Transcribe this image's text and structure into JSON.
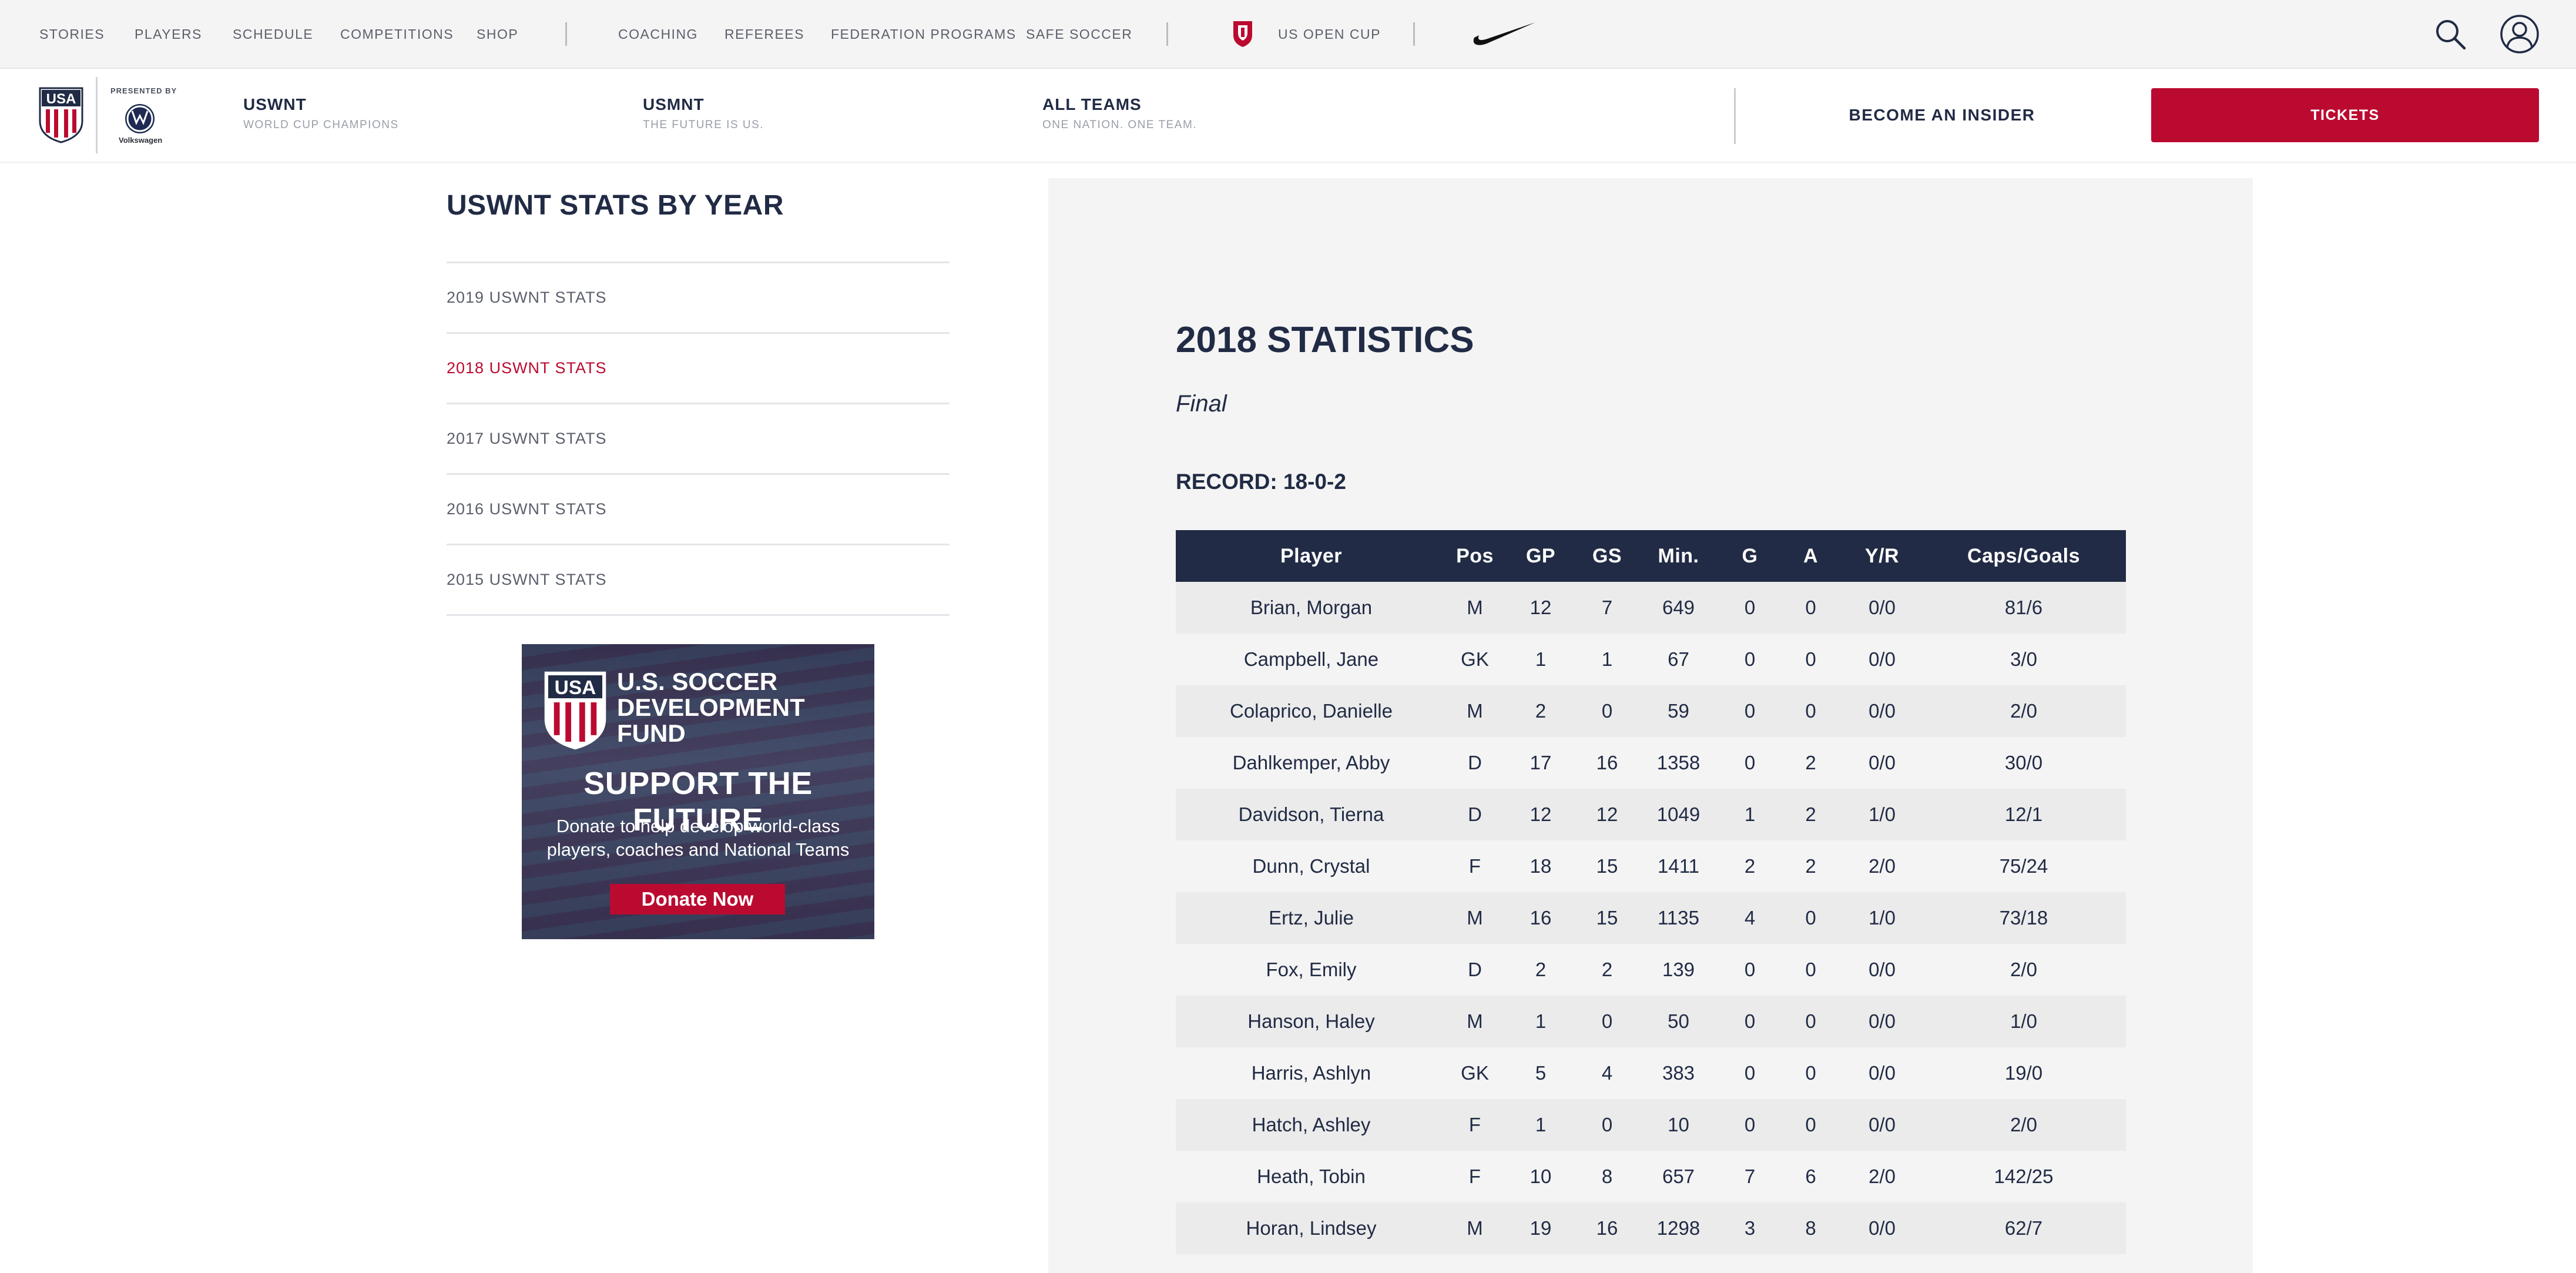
{
  "topnav": {
    "links": [
      "STORIES",
      "PLAYERS",
      "SCHEDULE",
      "COMPETITIONS",
      "SHOP",
      "COACHING",
      "REFEREES",
      "FEDERATION PROGRAMS",
      "SAFE SOCCER",
      "US OPEN CUP"
    ]
  },
  "header": {
    "logo_text": "USA",
    "presented_by": "PRESENTED BY",
    "sponsor": "Volkswagen",
    "teams": [
      {
        "title": "USWNT",
        "subtitle": "WORLD CUP CHAMPIONS"
      },
      {
        "title": "USMNT",
        "subtitle": "THE FUTURE IS US."
      },
      {
        "title": "ALL TEAMS",
        "subtitle": "ONE NATION. ONE TEAM."
      }
    ],
    "insider_label": "BECOME AN INSIDER",
    "tickets_label": "TICKETS"
  },
  "sidebar": {
    "title": "USWNT STATS BY YEAR",
    "items": [
      {
        "label": "2019 USWNT STATS",
        "active": false
      },
      {
        "label": "2018 USWNT STATS",
        "active": true
      },
      {
        "label": "2017 USWNT STATS",
        "active": false
      },
      {
        "label": "2016 USWNT STATS",
        "active": false
      },
      {
        "label": "2015 USWNT STATS",
        "active": false
      }
    ]
  },
  "ad": {
    "title": "U.S. SOCCER DEVELOPMENT FUND",
    "headline": "SUPPORT THE FUTURE",
    "body": "Donate to help develop world-class players, coaches and National Teams",
    "button": "Donate Now"
  },
  "stats": {
    "title": "2018 STATISTICS",
    "status": "Final",
    "record": "RECORD: 18-0-2",
    "columns": [
      "Player",
      "Pos",
      "GP",
      "GS",
      "Min.",
      "G",
      "A",
      "Y/R",
      "Caps/Goals"
    ],
    "rows": [
      [
        "Brian, Morgan",
        "M",
        "12",
        "7",
        "649",
        "0",
        "0",
        "0/0",
        "81/6"
      ],
      [
        "Campbell, Jane",
        "GK",
        "1",
        "1",
        "67",
        "0",
        "0",
        "0/0",
        "3/0"
      ],
      [
        "Colaprico, Danielle",
        "M",
        "2",
        "0",
        "59",
        "0",
        "0",
        "0/0",
        "2/0"
      ],
      [
        "Dahlkemper, Abby",
        "D",
        "17",
        "16",
        "1358",
        "0",
        "2",
        "0/0",
        "30/0"
      ],
      [
        "Davidson, Tierna",
        "D",
        "12",
        "12",
        "1049",
        "1",
        "2",
        "1/0",
        "12/1"
      ],
      [
        "Dunn, Crystal",
        "F",
        "18",
        "15",
        "1411",
        "2",
        "2",
        "2/0",
        "75/24"
      ],
      [
        "Ertz, Julie",
        "M",
        "16",
        "15",
        "1135",
        "4",
        "0",
        "1/0",
        "73/18"
      ],
      [
        "Fox, Emily",
        "D",
        "2",
        "2",
        "139",
        "0",
        "0",
        "0/0",
        "2/0"
      ],
      [
        "Hanson, Haley",
        "M",
        "1",
        "0",
        "50",
        "0",
        "0",
        "0/0",
        "1/0"
      ],
      [
        "Harris, Ashlyn",
        "GK",
        "5",
        "4",
        "383",
        "0",
        "0",
        "0/0",
        "19/0"
      ],
      [
        "Hatch, Ashley",
        "F",
        "1",
        "0",
        "10",
        "0",
        "0",
        "0/0",
        "2/0"
      ],
      [
        "Heath, Tobin",
        "F",
        "10",
        "8",
        "657",
        "7",
        "6",
        "2/0",
        "142/25"
      ],
      [
        "Horan, Lindsey",
        "M",
        "19",
        "16",
        "1298",
        "3",
        "8",
        "0/0",
        "62/7"
      ]
    ]
  },
  "colors": {
    "navy": "#212b45",
    "red": "#bb0a30",
    "panel": "#f4f4f4",
    "row_alt": "#ebebeb"
  },
  "icons": [
    "cup-icon",
    "nike-swoosh-icon",
    "search-icon",
    "account-icon",
    "usa-crest-icon",
    "volkswagen-icon"
  ]
}
